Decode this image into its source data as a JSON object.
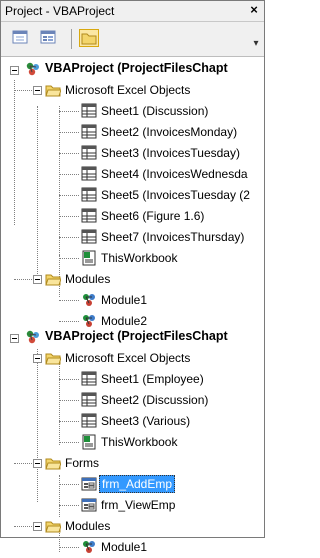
{
  "window": {
    "title": "Project - VBAProject",
    "close_label": "×"
  },
  "toolbar": {
    "buttons": [
      {
        "name": "view-code-button",
        "icon": "view-code-icon"
      },
      {
        "name": "view-object-button",
        "icon": "view-object-icon"
      },
      {
        "name": "toggle-folders-button",
        "icon": "folder-icon",
        "active": true
      }
    ]
  },
  "tree": {
    "project1": {
      "label": "VBAProject (ProjectFilesChapt",
      "excel_objects": {
        "label": "Microsoft Excel Objects",
        "items": [
          "Sheet1 (Discussion)",
          "Sheet2 (InvoicesMonday)",
          "Sheet3 (InvoicesTuesday)",
          "Sheet4 (InvoicesWednesda",
          "Sheet5 (InvoicesTuesday (2",
          "Sheet6 (Figure 1.6)",
          "Sheet7 (InvoicesThursday)",
          "ThisWorkbook"
        ]
      },
      "modules": {
        "label": "Modules",
        "items": [
          "Module1",
          "Module2"
        ]
      }
    },
    "project2": {
      "label": "VBAProject (ProjectFilesChapt",
      "excel_objects": {
        "label": "Microsoft Excel Objects",
        "items": [
          "Sheet1 (Employee)",
          "Sheet2 (Discussion)",
          "Sheet3 (Various)",
          "ThisWorkbook"
        ]
      },
      "forms": {
        "label": "Forms",
        "items": [
          "frm_AddEmp",
          "frm_ViewEmp"
        ],
        "selected": "frm_AddEmp"
      },
      "modules": {
        "label": "Modules",
        "items": [
          "Module1"
        ]
      }
    }
  },
  "colors": {
    "selection": "#3399ff",
    "folder": "#f3d56b",
    "module": "#1f8f3a"
  }
}
